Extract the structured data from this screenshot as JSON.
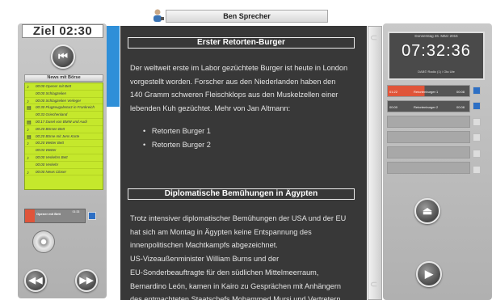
{
  "header": {
    "speaker": "Ben Sprecher",
    "speaker_icon": "user-icon"
  },
  "left": {
    "countdown": "Ziel 02:30",
    "news_title": "News mit Börse",
    "news_items": [
      {
        "icon": "note-icon",
        "text": "00:00 Opener mit Bett"
      },
      {
        "icon": "none",
        "text": "00:00 Schlagzeilen"
      },
      {
        "icon": "note-icon",
        "text": "00:00 Schlagzeilen Verleger"
      },
      {
        "icon": "doc-icon",
        "text": "00:30 Flugzeugabsturz in Frankreich"
      },
      {
        "icon": "none",
        "text": "00:33 Griechenland"
      },
      {
        "icon": "doc-icon",
        "text": "00:17 Dusel von BMW und Audi"
      },
      {
        "icon": "note-icon",
        "text": "00:20 Börsen Bett"
      },
      {
        "icon": "doc-icon",
        "text": "00:20 Börse mit Jens Korte"
      },
      {
        "icon": "note-icon",
        "text": "00:20 Wetter Bett"
      },
      {
        "icon": "none",
        "text": "00:03 Wetter"
      },
      {
        "icon": "note-icon",
        "text": "00:00 Verkehrs Bett"
      },
      {
        "icon": "none",
        "text": "00:00 Verkehr"
      },
      {
        "icon": "note-icon",
        "text": "00:00 News Closer"
      }
    ],
    "mini_player": {
      "label": "Opener mit Bett",
      "time": "01:33"
    }
  },
  "article": {
    "heading1": "Erster Retorten-Burger",
    "para1": [
      "Der weltweit erste im Labor gezüchtete Burger ist heute in London",
      "vorgestellt worden. Forscher aus den Niederlanden haben den",
      "140 Gramm schweren Fleischklops aus den Muskelzellen einer",
      "lebenden Kuh gezüchtet. Mehr von Jan Altmann:"
    ],
    "bullets": [
      "Retorten Burger 1",
      "Retorten Burger 2"
    ],
    "heading2": "Diplomatische Bemühungen in Ägypten",
    "para2": [
      "Trotz intensiver diplomatischer Bemühungen der USA und der EU",
      "hat sich am Montag in Ägypten keine Entspannung des",
      "innenpolitischen Machtkampfs abgezeichnet.",
      "US-Vizeaußenminister William Burns und der",
      "EU-Sonderbeauftragte für den südlichen Mittelmeerraum,",
      "Bernardino León, kamen in Kairo zu Gesprächen mit Anhängern",
      "des entmachteten Staatschefs Mohammed Mursi und Vertretern"
    ]
  },
  "right": {
    "clock_date": "Donnerstag 26. März 2015",
    "clock_time": "07:32:36",
    "clock_radio": "DAB© Radio (1) / Ola Ute",
    "players": [
      {
        "left": "01:22",
        "label": "Retortenburger 1",
        "right": "00:08"
      },
      {
        "left": "00:00",
        "label": "Retortenburger 2",
        "right": "00:08"
      }
    ]
  },
  "colors": {
    "accent_blue": "#2f8fd8",
    "news_green": "#c5e82c",
    "player_red": "#e0553a"
  }
}
